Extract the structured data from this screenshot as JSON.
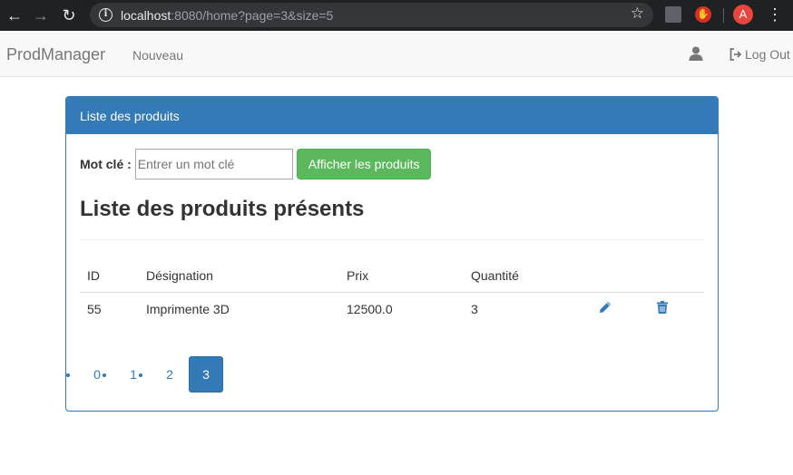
{
  "browser": {
    "url_host": "localhost",
    "url_rest": ":8080/home?page=3&size=5",
    "profile_initial": "A"
  },
  "navbar": {
    "brand": "ProdManager",
    "new_link": "Nouveau",
    "logout": "Log Out"
  },
  "panel": {
    "heading": "Liste des produits",
    "search_label": "Mot clé :",
    "search_placeholder": "Entrer un mot clé",
    "search_button": "Afficher les produits",
    "section_title": "Liste des produits présents"
  },
  "table": {
    "headers": [
      "ID",
      "Désignation",
      "Prix",
      "Quantité"
    ],
    "rows": [
      {
        "id": "55",
        "designation": "Imprimente 3D",
        "prix": "12500.0",
        "quantite": "3"
      }
    ]
  },
  "pagination": {
    "pages": [
      "0",
      "1",
      "2",
      "3"
    ],
    "active": "3"
  },
  "colors": {
    "primary": "#337ab7",
    "success": "#5cb85c"
  }
}
